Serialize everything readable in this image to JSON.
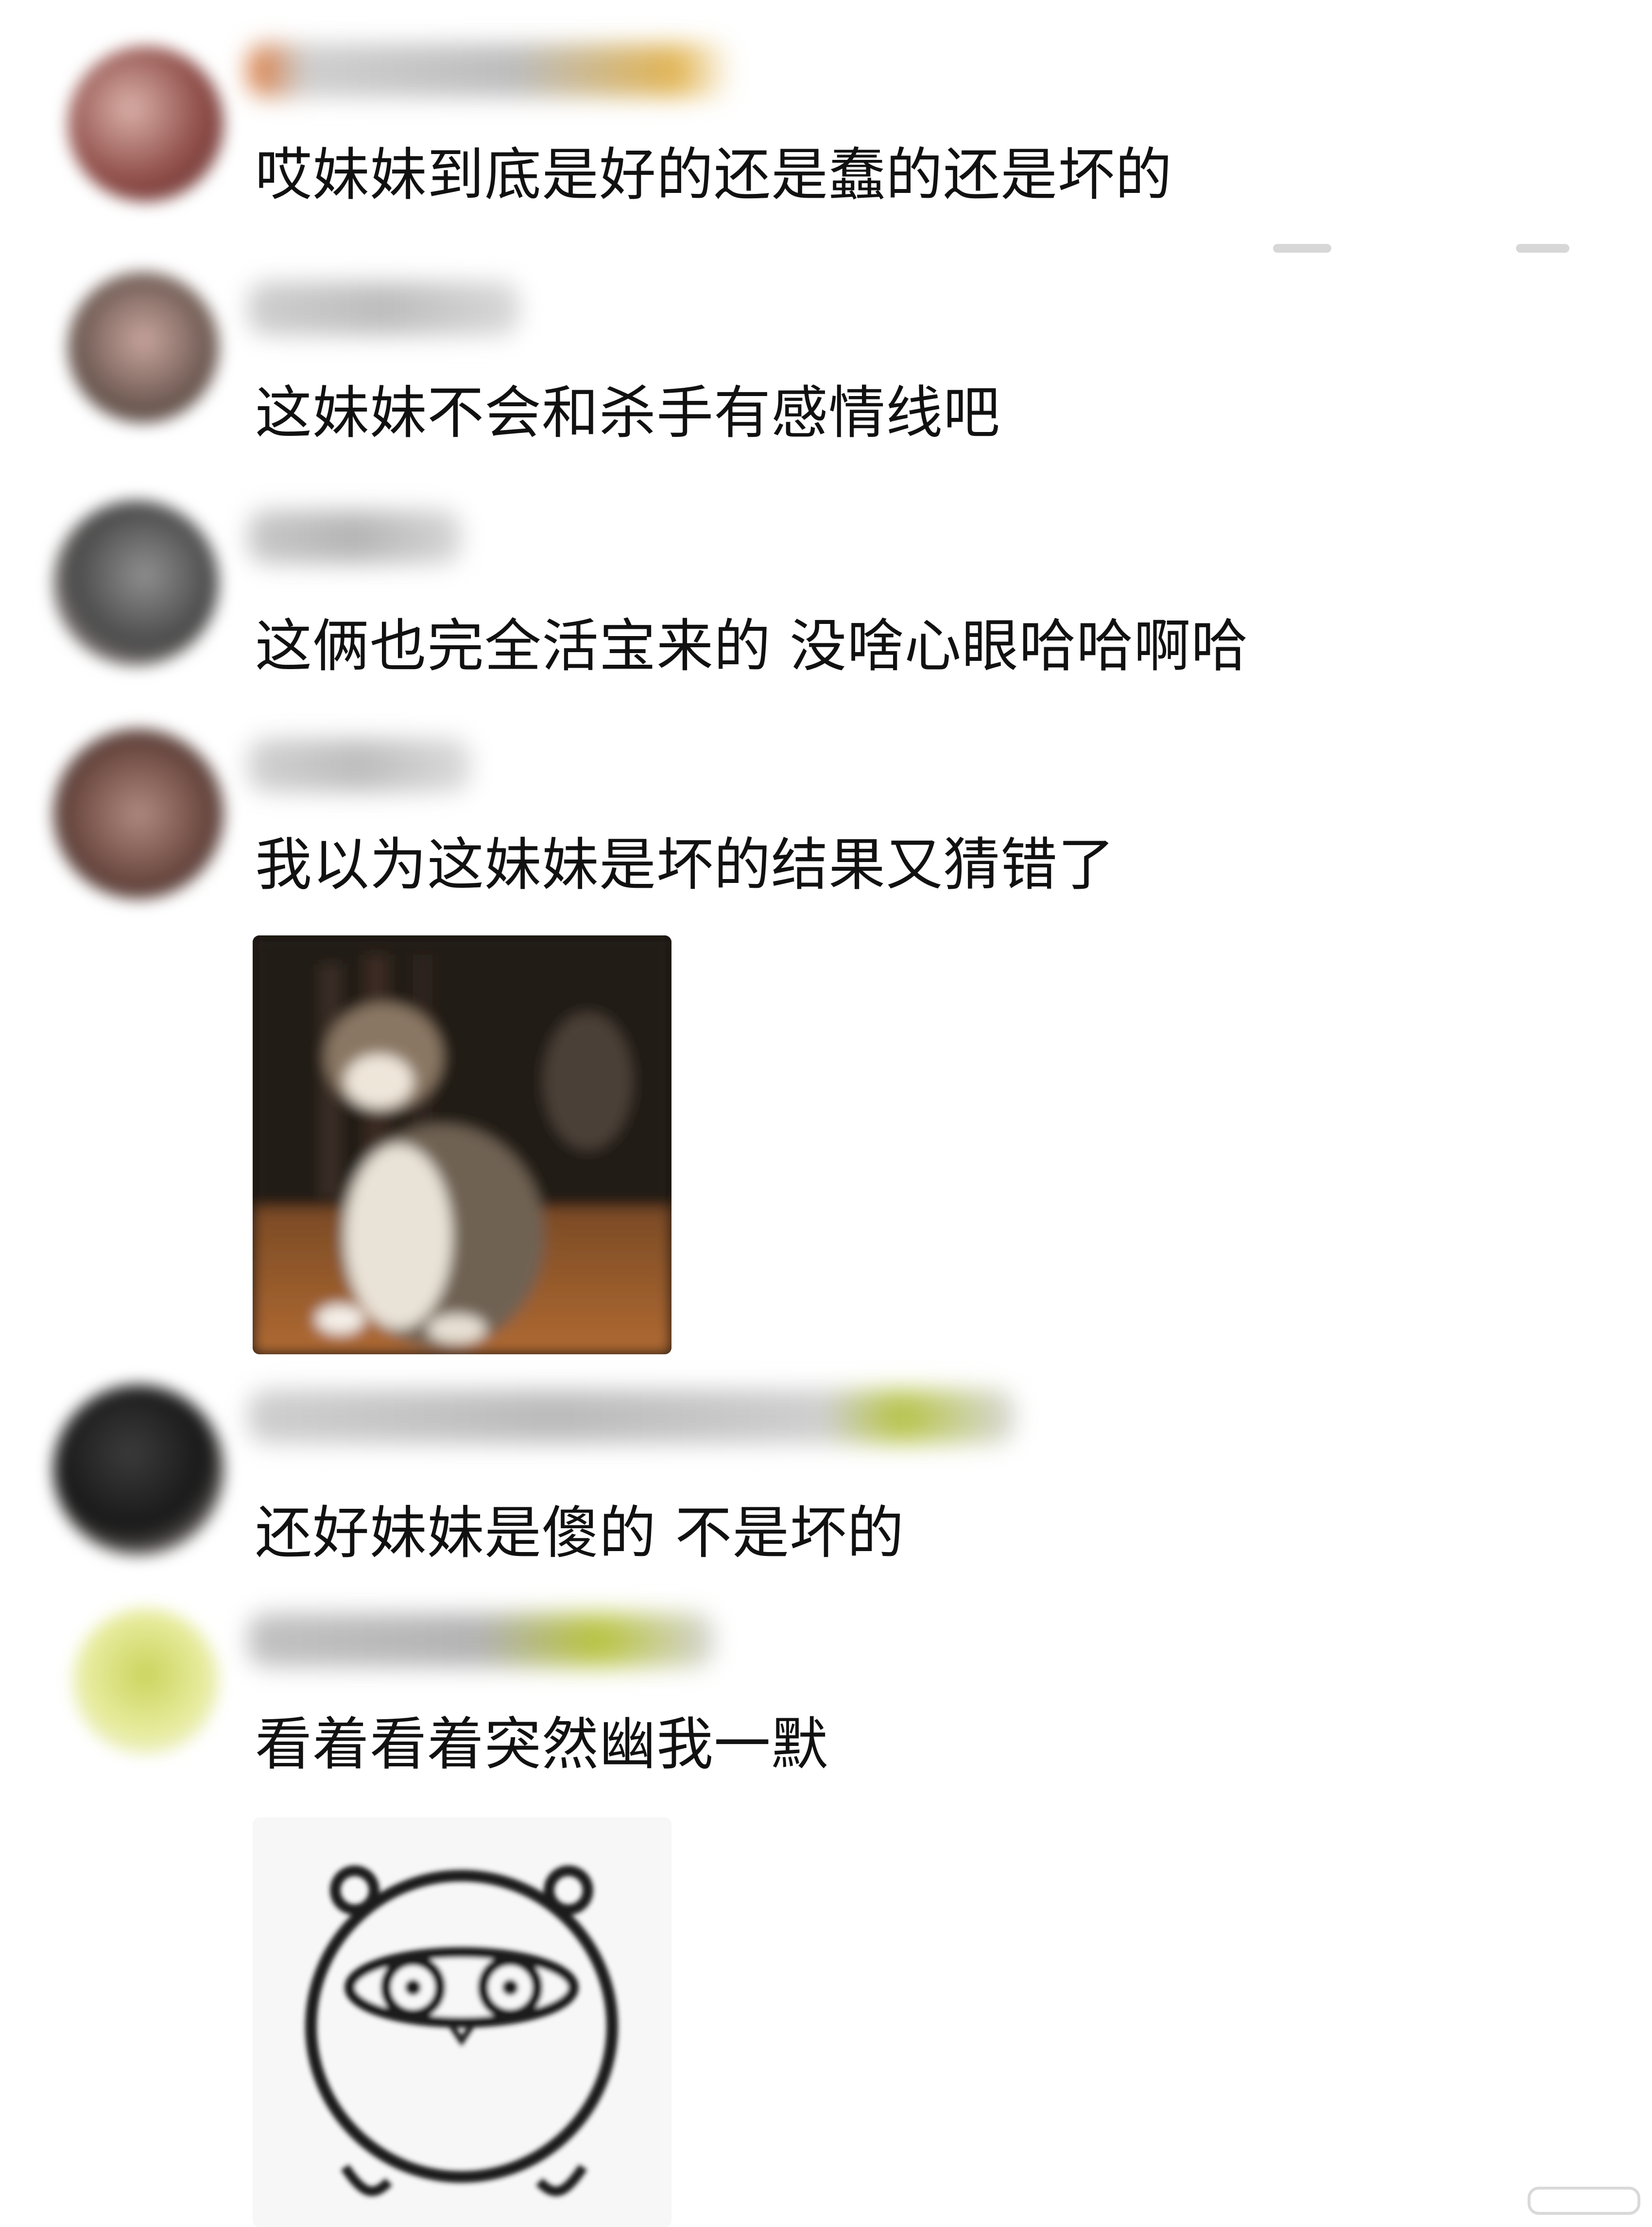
{
  "comments": [
    {
      "text": "哎妹妹到底是好的还是蠢的还是坏的"
    },
    {
      "text": "这妹妹不会和杀手有感情线吧"
    },
    {
      "text": "这俩也完全活宝来的 没啥心眼哈哈啊哈"
    },
    {
      "text": "我以为这妹妹是坏的结果又猜错了"
    },
    {
      "text": "还好妹妹是傻的 不是坏的"
    },
    {
      "text": "看着看着突然幽我一默"
    }
  ],
  "stickers": [
    {
      "icon": "screaming-cat-sticker"
    },
    {
      "icon": "round-face-sticker"
    }
  ],
  "colors": {
    "text": "#111111",
    "background": "#ffffff"
  }
}
